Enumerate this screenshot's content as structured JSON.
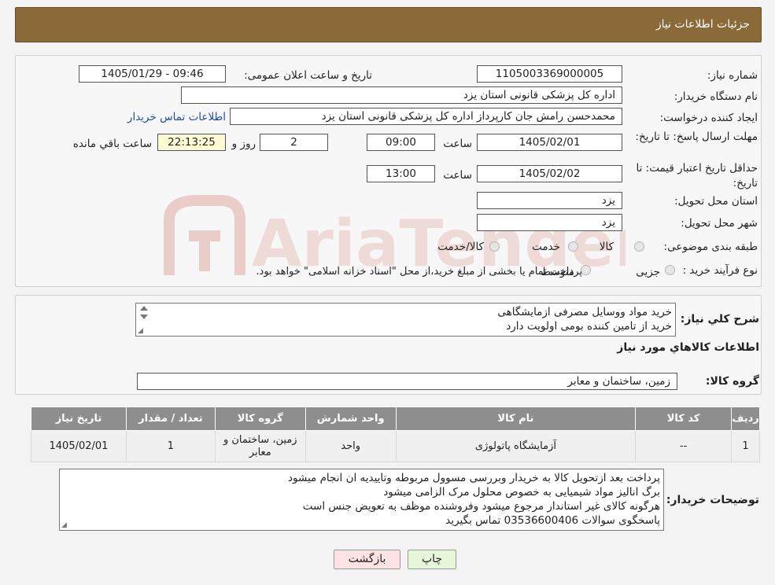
{
  "header": {
    "title": "جزئیات اطلاعات نیاز"
  },
  "form": {
    "need_number_label": "شماره نیاز:",
    "need_number": "1105003369000005",
    "announce_label": "تاریخ و ساعت اعلان عمومی:",
    "announce_value": "1405/01/29 - 09:46",
    "buyer_org_label": "نام دستگاه خریدار:",
    "buyer_org": "اداره کل پزشکی قانونی استان یزد",
    "creator_label": "ایجاد کننده درخواست:",
    "creator": "محمدحسن رامش جان کارپرداز اداره کل پزشکی قانونی استان یزد",
    "contact_link": "اطلاعات تماس خریدار",
    "deadline_label": "مهلت ارسال پاسخ: تا تاریخ:",
    "deadline_date": "1405/02/01",
    "time_label": "ساعت",
    "deadline_time": "09:00",
    "days_value": "2",
    "days_label": "روز و",
    "remaining_time": "22:13:25",
    "remaining_label": "ساعت باقي مانده",
    "validity_label": "حداقل تاریخ اعتبار قیمت: تا تاریخ:",
    "validity_date": "1405/02/02",
    "validity_time": "13:00",
    "province_label": "استان محل تحویل:",
    "province": "یزد",
    "city_label": "شهر محل تحویل:",
    "city": "یزد",
    "category_label": "طبقه بندی موضوعی:",
    "category_options": [
      "کالا",
      "خدمت",
      "کالا/خدمت"
    ],
    "process_label": "نوع فرآیند خرید :",
    "process_options": [
      "جزیی",
      "متوسط"
    ],
    "process_note": "پرداخت تمام یا بخشی از مبلغ خرید،از محل \"اسناد خزانه اسلامی\" خواهد بود."
  },
  "summary": {
    "description_label": "شرح کلي نياز:",
    "description_lines": [
      "خرید مواد ووسایل مصرفی ازمایشگاهی",
      "خرید از تامین کننده بومی اولویت دارد"
    ],
    "goods_info_title": "اطلاعات کالاهاي مورد نياز",
    "goods_group_label": "گروه کالا:",
    "goods_group": "زمین، ساختمان و معابر"
  },
  "table": {
    "headers": [
      "رديف",
      "کد کالا",
      "نام کالا",
      "واحد شمارش",
      "گروه کالا",
      "تعداد / مقدار",
      "تاريخ نياز"
    ],
    "rows": [
      [
        "1",
        "--",
        "آزمایشگاه پاتولوژی",
        "واحد",
        "زمین، ساختمان و معابر",
        "1",
        "1405/02/01"
      ]
    ]
  },
  "notes": {
    "label": "توضيحات خريدار:",
    "lines": [
      "پرداخت بعد ازتحویل کالا به خریدار وبررسی مسوول مربوطه وتاییدیه ان انجام میشود",
      "برگ انالیز مواد شیمیایی به خصوص محلول مرک الزامی میشود",
      "هرگونه کالای غیر استاندار مرجوع میشود وفروشنده موظف به تعویض جنس است",
      "پاسخگوی سوالات 03536600406 تماس بگیرید"
    ]
  },
  "buttons": {
    "back": "بازگشت",
    "print": "چاپ"
  },
  "watermark": "AriaTender.neT",
  "colors": {
    "header": "#8b6a3a",
    "table_header": "#8e8e8e",
    "back_button": "#fde3e3",
    "print_button": "#e6f7d9"
  }
}
